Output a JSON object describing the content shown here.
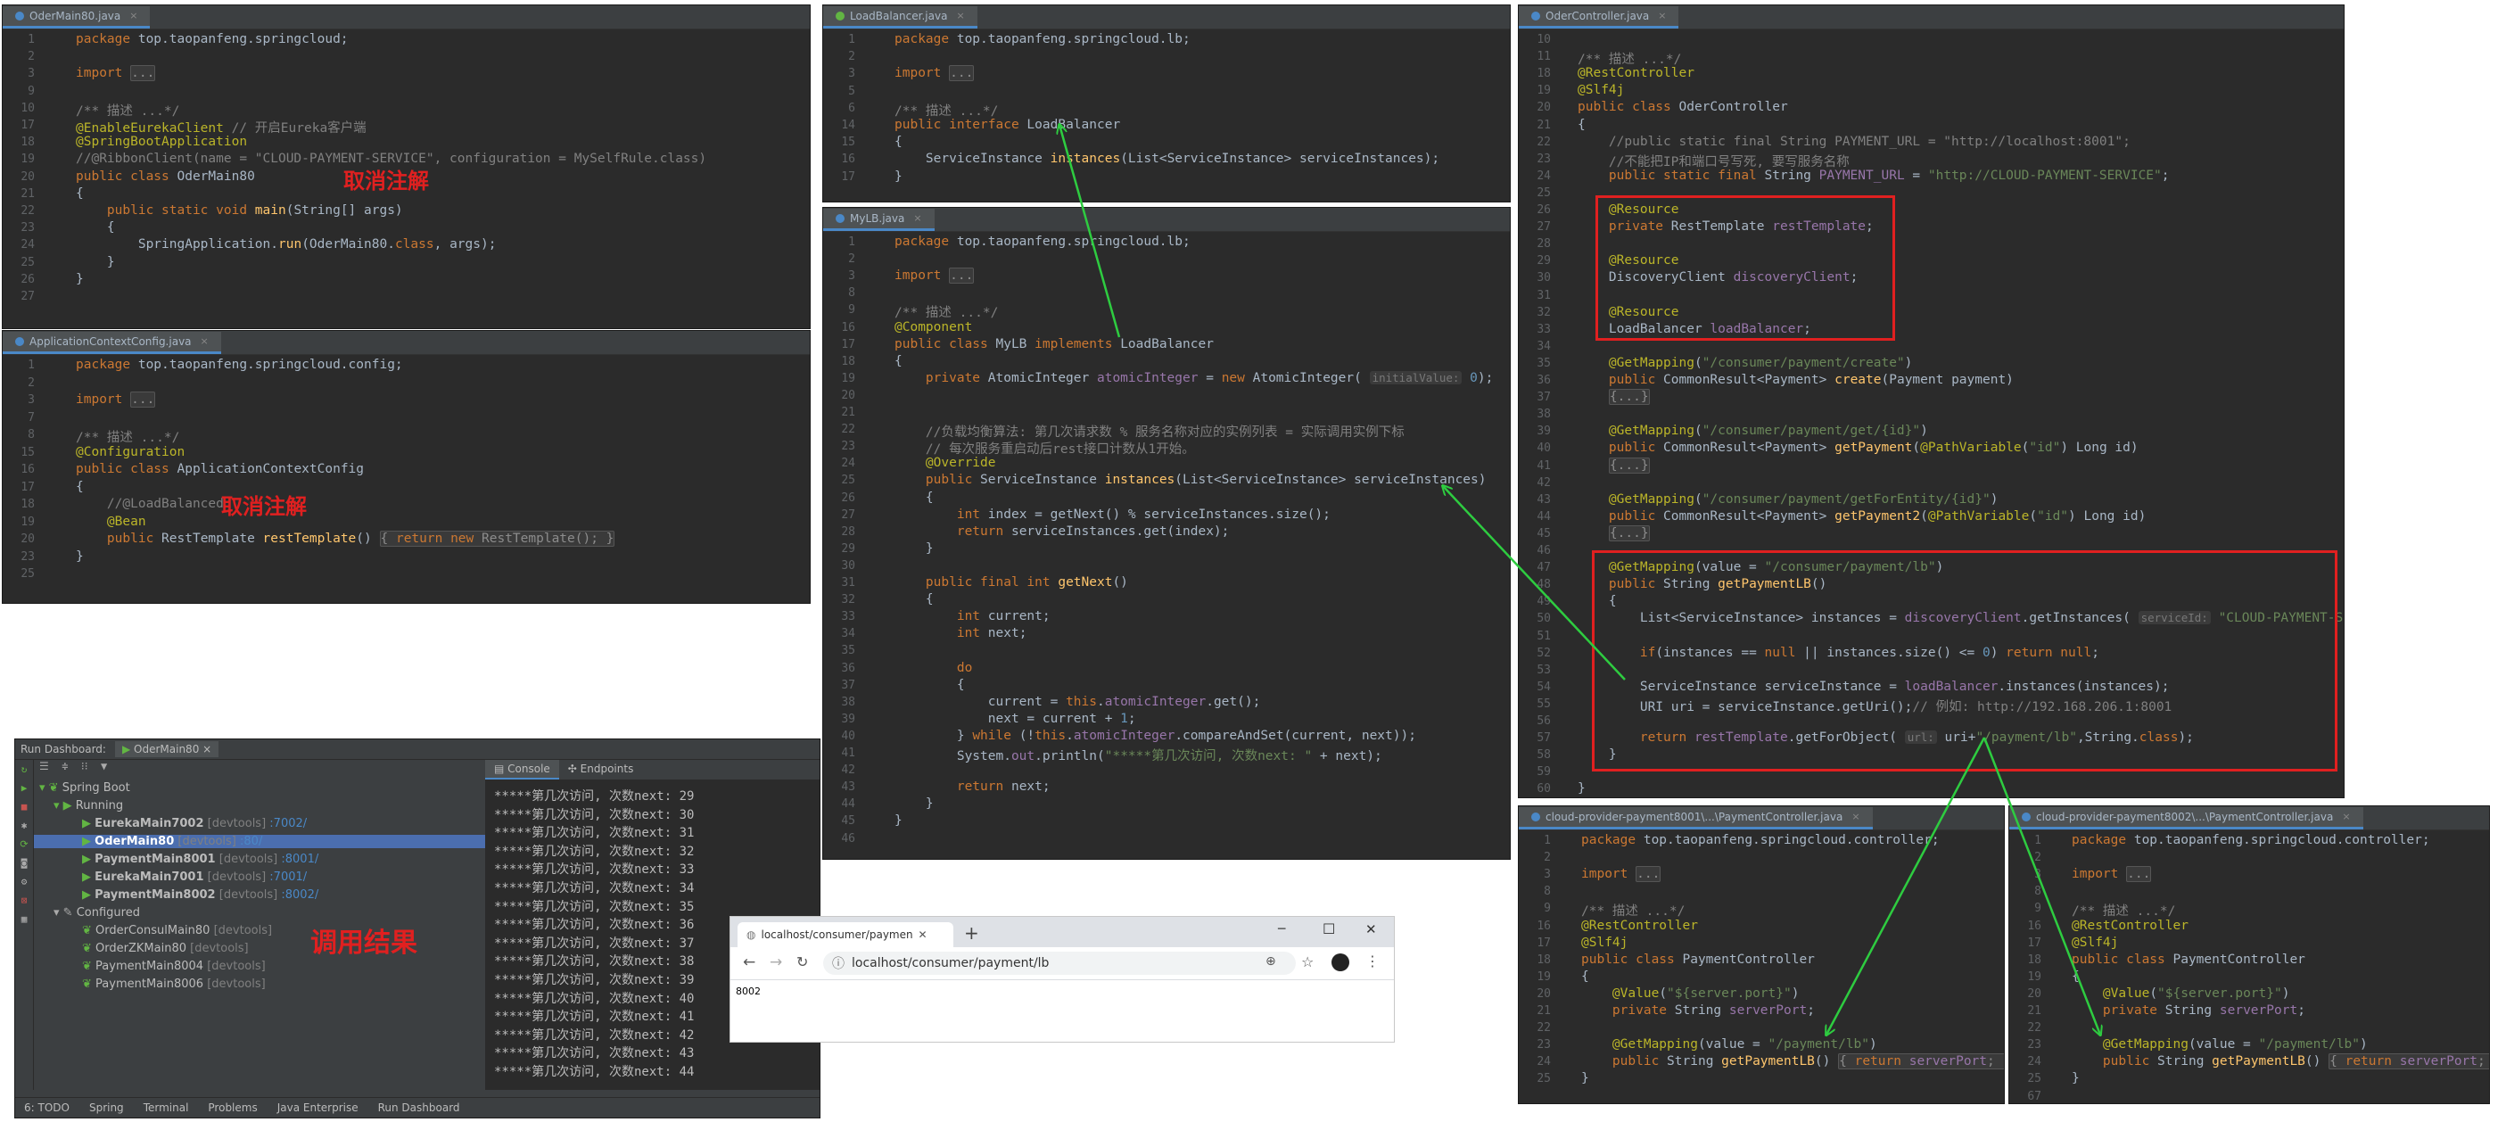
{
  "colors": {
    "arrow": "#2ecc40",
    "highlight_red": "#e02020",
    "editor_bg": "#2b2b2b"
  },
  "panels": {
    "odermain": {
      "tab": "OderMain80.java",
      "lines": [
        {
          "n": "1",
          "c": "<span class='kw'>package</span> top.taopanfeng.springcloud;"
        },
        {
          "n": "2",
          "c": ""
        },
        {
          "n": "3",
          "c": "<span class='kw'>import</span> <span class='fold'>...</span>"
        },
        {
          "n": "9",
          "c": ""
        },
        {
          "n": "10",
          "c": "<span class='cmt'>/** 描述 ...*/</span>"
        },
        {
          "n": "17",
          "c": "<span class='ann'>@EnableEurekaClient</span> <span class='cmt'>// 开启Eureka客户端</span>"
        },
        {
          "n": "18",
          "c": "<span class='ann'>@SpringBootApplication</span>"
        },
        {
          "n": "19",
          "c": "<span class='cmt'>//@RibbonClient(name = \"CLOUD-PAYMENT-SERVICE\", configuration = MySelfRule.class)</span>"
        },
        {
          "n": "20",
          "c": "<span class='kw'>public class</span> OderMain80"
        },
        {
          "n": "21",
          "c": "{"
        },
        {
          "n": "22",
          "c": "    <span class='kw'>public static void</span> <span class='mth'>main</span>(String[] args)"
        },
        {
          "n": "23",
          "c": "    {"
        },
        {
          "n": "24",
          "c": "        SpringApplication.<span class='mth'>run</span>(OderMain80.<span class='kw'>class</span>, args);"
        },
        {
          "n": "25",
          "c": "    }"
        },
        {
          "n": "26",
          "c": "}"
        },
        {
          "n": "27",
          "c": ""
        }
      ],
      "label": "取消注解"
    },
    "appconfig": {
      "tab": "ApplicationContextConfig.java",
      "lines": [
        {
          "n": "1",
          "c": "<span class='kw'>package</span> top.taopanfeng.springcloud.config;"
        },
        {
          "n": "2",
          "c": ""
        },
        {
          "n": "3",
          "c": "<span class='kw'>import</span> <span class='fold'>...</span>"
        },
        {
          "n": "7",
          "c": ""
        },
        {
          "n": "8",
          "c": "<span class='cmt'>/** 描述 ...*/</span>"
        },
        {
          "n": "15",
          "c": "<span class='ann'>@Configuration</span>"
        },
        {
          "n": "16",
          "c": "<span class='kw'>public class</span> ApplicationContextConfig"
        },
        {
          "n": "17",
          "c": "{"
        },
        {
          "n": "18",
          "c": "    <span class='cmt'>//@LoadBalanced</span>"
        },
        {
          "n": "19",
          "c": "    <span class='ann'>@Bean</span>"
        },
        {
          "n": "20",
          "c": "    <span class='kw'>public</span> RestTemplate <span class='mth'>restTemplate</span>() <span class='fold'>{ <span class='kw'>return new</span> RestTemplate(); }</span>"
        },
        {
          "n": "23",
          "c": "}"
        },
        {
          "n": "25",
          "c": ""
        }
      ],
      "label": "取消注解"
    },
    "loadbalancer": {
      "tab": "LoadBalancer.java",
      "lines": [
        {
          "n": "1",
          "c": "<span class='kw'>package</span> top.taopanfeng.springcloud.lb;"
        },
        {
          "n": "2",
          "c": ""
        },
        {
          "n": "3",
          "c": "<span class='kw'>import</span> <span class='fold'>...</span>"
        },
        {
          "n": "5",
          "c": ""
        },
        {
          "n": "6",
          "c": "<span class='cmt'>/** 描述 ...*/</span>"
        },
        {
          "n": "14",
          "c": "<span class='kw'>public interface</span> LoadBalancer"
        },
        {
          "n": "15",
          "c": "{"
        },
        {
          "n": "16",
          "c": "    ServiceInstance <span class='mth'>instances</span>(List&lt;ServiceInstance&gt; serviceInstances);"
        },
        {
          "n": "17",
          "c": "}"
        }
      ]
    },
    "mylb": {
      "tab": "MyLB.java",
      "lines": [
        {
          "n": "1",
          "c": "<span class='kw'>package</span> top.taopanfeng.springcloud.lb;"
        },
        {
          "n": "2",
          "c": ""
        },
        {
          "n": "3",
          "c": "<span class='kw'>import</span> <span class='fold'>...</span>"
        },
        {
          "n": "8",
          "c": ""
        },
        {
          "n": "9",
          "c": "<span class='cmt'>/** 描述 ...*/</span>"
        },
        {
          "n": "16",
          "c": "<span class='ann'>@Component</span>"
        },
        {
          "n": "17",
          "c": "<span class='kw'>public class</span> MyLB <span class='kw'>implements</span> LoadBalancer"
        },
        {
          "n": "18",
          "c": "{"
        },
        {
          "n": "19",
          "c": "    <span class='kw'>private</span> AtomicInteger <span class='fld'>atomicInteger</span> = <span class='kw'>new</span> AtomicInteger( <span class='hint'>initialValue:</span> <span class='num'>0</span>);"
        },
        {
          "n": "20",
          "c": ""
        },
        {
          "n": "21",
          "c": ""
        },
        {
          "n": "22",
          "c": "    <span class='cmt'>//负载均衡算法: 第几次请求数 % 服务名称对应的实例列表 = 实际调用实例下标</span>"
        },
        {
          "n": "23",
          "c": "    <span class='cmt'>// 每次服务重启动后rest接口计数从1开始。</span>"
        },
        {
          "n": "24",
          "c": "    <span class='ann'>@Override</span>"
        },
        {
          "n": "25",
          "c": "    <span class='kw'>public</span> ServiceInstance <span class='mth'>instances</span>(List&lt;ServiceInstance&gt; serviceInstances)"
        },
        {
          "n": "26",
          "c": "    {"
        },
        {
          "n": "27",
          "c": "        <span class='kw'>int</span> index = getNext() % serviceInstances.size();"
        },
        {
          "n": "28",
          "c": "        <span class='kw'>return</span> serviceInstances.get(index);"
        },
        {
          "n": "29",
          "c": "    }"
        },
        {
          "n": "30",
          "c": ""
        },
        {
          "n": "31",
          "c": "    <span class='kw'>public final int</span> <span class='mth'>getNext</span>()"
        },
        {
          "n": "32",
          "c": "    {"
        },
        {
          "n": "33",
          "c": "        <span class='kw'>int</span> current;"
        },
        {
          "n": "34",
          "c": "        <span class='kw'>int</span> next;"
        },
        {
          "n": "35",
          "c": ""
        },
        {
          "n": "36",
          "c": "        <span class='kw'>do</span>"
        },
        {
          "n": "37",
          "c": "        {"
        },
        {
          "n": "38",
          "c": "            current = <span class='kw'>this</span>.<span class='fld'>atomicInteger</span>.get();"
        },
        {
          "n": "39",
          "c": "            next = current + <span class='num'>1</span>;"
        },
        {
          "n": "40",
          "c": "        } <span class='kw'>while</span> (!<span class='kw'>this</span>.<span class='fld'>atomicInteger</span>.compareAndSet(current, next));"
        },
        {
          "n": "41",
          "c": "        System.<span class='fld'>out</span>.println(<span class='str'>\"*****第几次访问, 次数next: \"</span> + next);"
        },
        {
          "n": "42",
          "c": ""
        },
        {
          "n": "43",
          "c": "        <span class='kw'>return</span> next;"
        },
        {
          "n": "44",
          "c": "    }"
        },
        {
          "n": "45",
          "c": "}"
        },
        {
          "n": "46",
          "c": ""
        }
      ]
    },
    "odercontroller": {
      "tab": "OderController.java",
      "lines": [
        {
          "n": "10",
          "c": ""
        },
        {
          "n": "11",
          "c": "<span class='cmt'>/** 描述 ...*/</span>"
        },
        {
          "n": "18",
          "c": "<span class='ann'>@RestController</span>"
        },
        {
          "n": "19",
          "c": "<span class='ann'>@Slf4j</span>"
        },
        {
          "n": "20",
          "c": "<span class='kw'>public class</span> OderController"
        },
        {
          "n": "21",
          "c": "{"
        },
        {
          "n": "22",
          "c": "    <span class='cmt'>//public static final String PAYMENT_URL = \"http://localhost:8001\";</span>"
        },
        {
          "n": "23",
          "c": "    <span class='cmt'>//不能把IP和端口号写死, 要写服务名称</span>"
        },
        {
          "n": "24",
          "c": "    <span class='kw'>public static final</span> String <span class='fld'>PAYMENT_URL</span> = <span class='str'>\"http://CLOUD-PAYMENT-SERVICE\"</span>;"
        },
        {
          "n": "25",
          "c": ""
        },
        {
          "n": "26",
          "c": "    <span class='ann'>@Resource</span>"
        },
        {
          "n": "27",
          "c": "    <span class='kw'>private</span> RestTemplate <span class='fld'>restTemplate</span>;"
        },
        {
          "n": "28",
          "c": ""
        },
        {
          "n": "29",
          "c": "    <span class='ann'>@Resource</span>"
        },
        {
          "n": "30",
          "c": "    DiscoveryClient <span class='fld'>discoveryClient</span>;"
        },
        {
          "n": "31",
          "c": ""
        },
        {
          "n": "32",
          "c": "    <span class='ann'>@Resource</span>"
        },
        {
          "n": "33",
          "c": "    LoadBalancer <span class='fld'>loadBalancer</span>;"
        },
        {
          "n": "34",
          "c": ""
        },
        {
          "n": "35",
          "c": "    <span class='ann'>@GetMapping</span>(<span class='str'>\"/consumer/payment/create\"</span>)"
        },
        {
          "n": "36",
          "c": "    <span class='kw'>public</span> CommonResult&lt;Payment&gt; <span class='mth'>create</span>(Payment payment)"
        },
        {
          "n": "37",
          "c": "    <span class='fold'>{...}</span>"
        },
        {
          "n": "38",
          "c": ""
        },
        {
          "n": "39",
          "c": "    <span class='ann'>@GetMapping</span>(<span class='str'>\"/consumer/payment/get/{id}\"</span>)"
        },
        {
          "n": "40",
          "c": "    <span class='kw'>public</span> CommonResult&lt;Payment&gt; <span class='mth'>getPayment</span>(<span class='ann'>@PathVariable</span>(<span class='str'>\"id\"</span>) Long id)"
        },
        {
          "n": "41",
          "c": "    <span class='fold'>{...}</span>"
        },
        {
          "n": "42",
          "c": ""
        },
        {
          "n": "43",
          "c": "    <span class='ann'>@GetMapping</span>(<span class='str'>\"/consumer/payment/getForEntity/{id}\"</span>)"
        },
        {
          "n": "44",
          "c": "    <span class='kw'>public</span> CommonResult&lt;Payment&gt; <span class='mth'>getPayment2</span>(<span class='ann'>@PathVariable</span>(<span class='str'>\"id\"</span>) Long id)"
        },
        {
          "n": "45",
          "c": "    <span class='fold'>{...}</span>"
        },
        {
          "n": "46",
          "c": ""
        },
        {
          "n": "47",
          "c": "    <span class='ann'>@GetMapping</span>(value = <span class='str'>\"/consumer/payment/lb\"</span>)"
        },
        {
          "n": "48",
          "c": "    <span class='kw'>public</span> String <span class='mth'>getPaymentLB</span>()"
        },
        {
          "n": "49",
          "c": "    {"
        },
        {
          "n": "50",
          "c": "        List&lt;ServiceInstance&gt; instances = <span class='fld'>discoveryClient</span>.getInstances( <span class='hint'>serviceId:</span> <span class='str'>\"CLOUD-PAYMENT-SERVICE\"</span>);"
        },
        {
          "n": "51",
          "c": ""
        },
        {
          "n": "52",
          "c": "        <span class='kw'>if</span>(instances == <span class='kw'>null</span> || instances.size() &lt;= <span class='num'>0</span>) <span class='kw'>return null</span>;"
        },
        {
          "n": "53",
          "c": ""
        },
        {
          "n": "54",
          "c": "        ServiceInstance serviceInstance = <span class='fld'>loadBalancer</span>.instances(instances);"
        },
        {
          "n": "55",
          "c": "        URI uri = serviceInstance.getUri();<span class='cmt'>// 例如: http://192.168.206.1:8001</span>"
        },
        {
          "n": "56",
          "c": ""
        },
        {
          "n": "57",
          "c": "        <span class='kw'>return</span> <span class='fld'>restTemplate</span>.getForObject( <span class='hint'>url:</span> uri+<span class='str'>\"/payment/lb\"</span>,String.<span class='kw'>class</span>);"
        },
        {
          "n": "58",
          "c": "    }"
        },
        {
          "n": "59",
          "c": ""
        },
        {
          "n": "60",
          "c": "}"
        }
      ]
    },
    "pc8001": {
      "tab": "cloud-provider-payment8001\\...\\PaymentController.java",
      "lines": [
        {
          "n": "1",
          "c": "<span class='kw'>package</span> top.taopanfeng.springcloud.controller;"
        },
        {
          "n": "2",
          "c": ""
        },
        {
          "n": "3",
          "c": "<span class='kw'>import</span> <span class='fold'>...</span>"
        },
        {
          "n": "8",
          "c": ""
        },
        {
          "n": "9",
          "c": "<span class='cmt'>/** 描述 ...*/</span>"
        },
        {
          "n": "16",
          "c": "<span class='ann'>@RestController</span>"
        },
        {
          "n": "17",
          "c": "<span class='ann'>@Slf4j</span>"
        },
        {
          "n": "18",
          "c": "<span class='kw'>public class</span> PaymentController"
        },
        {
          "n": "19",
          "c": "{"
        },
        {
          "n": "20",
          "c": "    <span class='ann'>@Value</span>(<span class='str'>\"${server.port}\"</span>)"
        },
        {
          "n": "21",
          "c": "    <span class='kw'>private</span> String <span class='fld'>serverPort</span>;"
        },
        {
          "n": "22",
          "c": ""
        },
        {
          "n": "23",
          "c": "    <span class='ann'>@GetMapping</span>(value = <span class='str'>\"/payment/lb\"</span>)"
        },
        {
          "n": "24",
          "c": "    <span class='kw'>public</span> String <span class='mth'>getPaymentLB</span>() <span class='fold'>{ <span class='kw'>return</span> <span class='fld'>serverPort</span>; }</span>"
        },
        {
          "n": "25",
          "c": "}"
        }
      ]
    },
    "pc8002": {
      "tab": "cloud-provider-payment8002\\...\\PaymentController.java",
      "lines": [
        {
          "n": "1",
          "c": "<span class='kw'>package</span> top.taopanfeng.springcloud.controller;"
        },
        {
          "n": "2",
          "c": ""
        },
        {
          "n": "3",
          "c": "<span class='kw'>import</span> <span class='fold'>...</span>"
        },
        {
          "n": "8",
          "c": ""
        },
        {
          "n": "9",
          "c": "<span class='cmt'>/** 描述 ...*/</span>"
        },
        {
          "n": "16",
          "c": "<span class='ann'>@RestController</span>"
        },
        {
          "n": "17",
          "c": "<span class='ann'>@Slf4j</span>"
        },
        {
          "n": "18",
          "c": "<span class='kw'>public class</span> PaymentController"
        },
        {
          "n": "19",
          "c": "{"
        },
        {
          "n": "20",
          "c": "    <span class='ann'>@Value</span>(<span class='str'>\"${server.port}\"</span>)"
        },
        {
          "n": "21",
          "c": "    <span class='kw'>private</span> String <span class='fld'>serverPort</span>;"
        },
        {
          "n": "22",
          "c": ""
        },
        {
          "n": "23",
          "c": "    <span class='ann'>@GetMapping</span>(value = <span class='str'>\"/payment/lb\"</span>)"
        },
        {
          "n": "24",
          "c": "    <span class='kw'>public</span> String <span class='mth'>getPaymentLB</span>() <span class='fold'>{ <span class='kw'>return</span> <span class='fld'>serverPort</span>; }</span>"
        },
        {
          "n": "25",
          "c": "}"
        },
        {
          "n": "67",
          "c": ""
        }
      ]
    }
  },
  "run_dashboard": {
    "title": "Run Dashboard:",
    "config_tab": "OderMain80",
    "spring_boot": "Spring Boot",
    "running": "Running",
    "configured": "Configured",
    "running_apps": [
      {
        "name": "EurekaMain7002",
        "dev": "[devtools]",
        "port": ":7002/"
      },
      {
        "name": "OderMain80",
        "dev": "[devtools]",
        "port": ":80/"
      },
      {
        "name": "PaymentMain8001",
        "dev": "[devtools]",
        "port": ":8001/"
      },
      {
        "name": "EurekaMain7001",
        "dev": "[devtools]",
        "port": ":7001/"
      },
      {
        "name": "PaymentMain8002",
        "dev": "[devtools]",
        "port": ":8002/"
      }
    ],
    "configured_apps": [
      {
        "name": "OrderConsulMain80",
        "dev": "[devtools]"
      },
      {
        "name": "OrderZKMain80",
        "dev": "[devtools]"
      },
      {
        "name": "PaymentMain8004",
        "dev": "[devtools]"
      },
      {
        "name": "PaymentMain8006",
        "dev": "[devtools]"
      }
    ],
    "console_tab": "Console",
    "endpoints_tab": "Endpoints",
    "console_lines": [
      "*****第几次访问, 次数next: 29",
      "*****第几次访问, 次数next: 30",
      "*****第几次访问, 次数next: 31",
      "*****第几次访问, 次数next: 32",
      "*****第几次访问, 次数next: 33",
      "*****第几次访问, 次数next: 34",
      "*****第几次访问, 次数next: 35",
      "*****第几次访问, 次数next: 36",
      "*****第几次访问, 次数next: 37",
      "*****第几次访问, 次数next: 38",
      "*****第几次访问, 次数next: 39",
      "*****第几次访问, 次数next: 40",
      "*****第几次访问, 次数next: 41",
      "*****第几次访问, 次数next: 42",
      "*****第几次访问, 次数next: 43",
      "*****第几次访问, 次数next: 44"
    ],
    "result_label": "调用结果",
    "bottom_tabs": [
      "6: TODO",
      "Spring",
      "Terminal",
      "Problems",
      "Java Enterprise",
      "Run Dashboard"
    ]
  },
  "browser": {
    "tab_title": "localhost/consumer/payment/...",
    "new_tab": "+",
    "url": "localhost/consumer/payment/lb",
    "content": "8002",
    "min": "─",
    "max": "☐",
    "close": "✕"
  }
}
